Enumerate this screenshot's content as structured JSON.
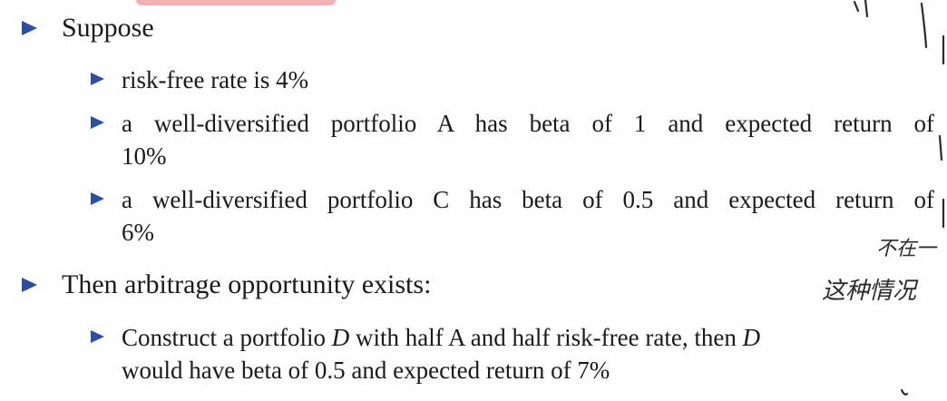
{
  "bullets": [
    {
      "text": "Suppose",
      "sub": [
        {
          "text": "risk-free rate is 4%"
        },
        {
          "line1": "a well-diversified portfolio A has beta of 1 and expected return of",
          "line2": "10%"
        },
        {
          "line1": "a well-diversified portfolio C has beta of 0.5 and expected return of",
          "line2": "6%"
        }
      ]
    },
    {
      "text": "Then arbitrage opportunity exists:",
      "sub": [
        {
          "line1_pre": "Construct a portfolio ",
          "line1_var": "D",
          "line1_mid": " with half A and half risk-free rate, then ",
          "line1_var2": "D",
          "line2": "would have beta of 0.5 and expected return of 7%"
        }
      ]
    }
  ],
  "handwriting": {
    "line1": "不在一",
    "line2": "这种情况"
  },
  "colors": {
    "bullet": "#2c4fa3",
    "highlight": "#f2a3a8",
    "text": "#1a1a1a"
  }
}
